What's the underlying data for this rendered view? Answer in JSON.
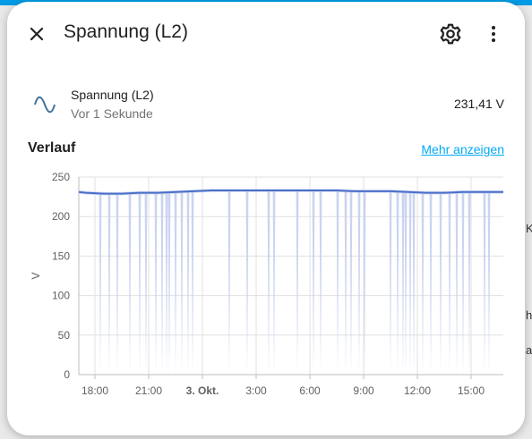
{
  "dialog": {
    "title": "Spannung (L2)",
    "icons": {
      "close": "close-icon",
      "settings": "gear-icon",
      "menu": "more-vert-icon",
      "entity": "sine-wave-icon"
    }
  },
  "entity": {
    "name": "Spannung (L2)",
    "last_changed": "Vor 1 Sekunde",
    "state": "231,41 V"
  },
  "history": {
    "title": "Verlauf",
    "show_more": "Mehr anzeigen"
  },
  "background_fragments": [
    "K",
    "he",
    "a"
  ],
  "colors": {
    "accent": "#039be5",
    "line": "#4a6fc8",
    "band": "#c4cff0",
    "link": "#03a9f4"
  },
  "chart_data": {
    "type": "line",
    "ylabel": "V",
    "ylim": [
      0,
      250
    ],
    "yticks": [
      0,
      50,
      100,
      150,
      200,
      250
    ],
    "x_tick_labels": [
      "18:00",
      "21:00",
      "3. Okt.",
      "3:00",
      "6:00",
      "9:00",
      "12:00",
      "15:00"
    ],
    "x_tick_hours": [
      18,
      21,
      24,
      27,
      30,
      33,
      36,
      39
    ],
    "x_range_hours": [
      17.1,
      40.8
    ],
    "grid": true,
    "series": [
      {
        "values_label": "mean",
        "x_hours": [
          17.1,
          17.5,
          18.5,
          19.5,
          20.5,
          21.5,
          22.5,
          23.5,
          24.5,
          25.5,
          26.5,
          27.5,
          28.5,
          29.5,
          30.5,
          31.5,
          32.5,
          33.5,
          34.5,
          35.5,
          36.5,
          37.5,
          38.5,
          39.5,
          40.8
        ],
        "y": [
          231,
          230,
          229,
          229,
          230,
          230,
          231,
          232,
          233,
          233,
          233,
          233,
          233,
          233,
          233,
          233,
          232,
          232,
          232,
          231,
          230,
          230,
          231,
          231,
          231
        ]
      }
    ],
    "dips_to_zero_hours": [
      18.3,
      18.8,
      19.25,
      19.95,
      20.5,
      20.85,
      21.4,
      21.75,
      22.0,
      22.15,
      22.5,
      22.85,
      23.2,
      23.45,
      25.5,
      26.5,
      27.7,
      28.0,
      29.3,
      30.2,
      30.6,
      31.55,
      32.0,
      32.3,
      32.75,
      33.05,
      34.5,
      34.9,
      35.2,
      35.35,
      35.6,
      35.8,
      36.3,
      36.75,
      37.3,
      37.8,
      38.2,
      38.55,
      38.9,
      39.75,
      40.0
    ]
  }
}
